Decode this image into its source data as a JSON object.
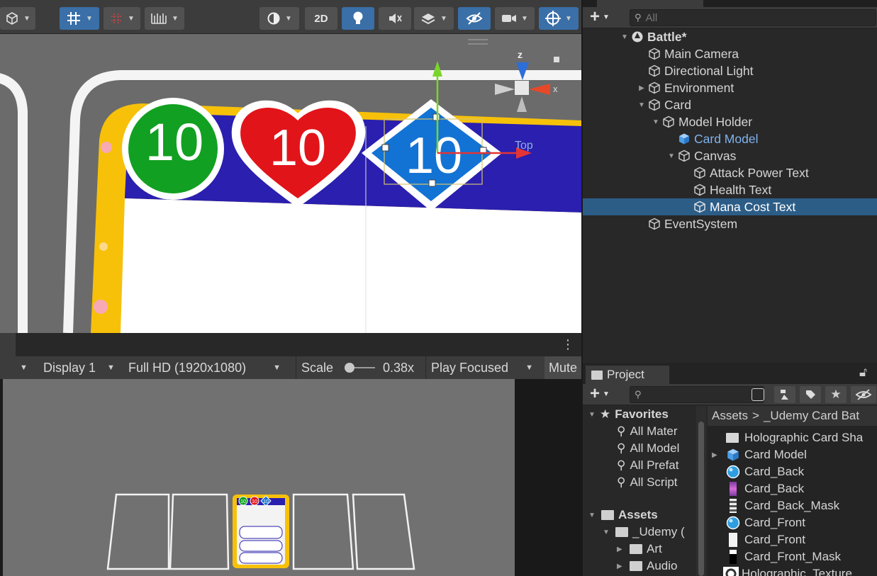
{
  "scene": {
    "toolbar": {
      "btn_2d_label": "2D"
    },
    "gizmo_axis_z": "z",
    "gizmo_axis_x": "x",
    "gizmo_view_label": "Top",
    "card": {
      "attack_value": "10",
      "health_value": "10",
      "mana_value": "10"
    },
    "colors": {
      "attack": "#12a022",
      "health": "#e1141a",
      "mana": "#1273d4",
      "card_border": "#f7c10a",
      "card_band": "#2a1fae"
    }
  },
  "game": {
    "display": "Display 1",
    "resolution": "Full HD (1920x1080)",
    "scale_label": "Scale",
    "scale_value": "0.38x",
    "play_mode": "Play Focused",
    "mute_label": "Mute",
    "mini_card_values": [
      "10",
      "10",
      "10"
    ]
  },
  "hierarchy": {
    "search_placeholder": "All",
    "scene_name": "Battle*",
    "items": [
      {
        "label": "Main Camera"
      },
      {
        "label": "Directional Light"
      },
      {
        "label": "Environment"
      },
      {
        "label": "Card"
      },
      {
        "label": "Model Holder"
      },
      {
        "label": "Card Model"
      },
      {
        "label": "Canvas"
      },
      {
        "label": "Attack Power Text"
      },
      {
        "label": "Health Text"
      },
      {
        "label": "Mana Cost Text"
      },
      {
        "label": "EventSystem"
      }
    ]
  },
  "project": {
    "tab_label": "Project",
    "favorites_label": "Favorites",
    "favorites": [
      "All Mater",
      "All Model",
      "All Prefat",
      "All Script"
    ],
    "assets_label": "Assets",
    "asset_folders": [
      "_Udemy (",
      "Art",
      "Audio"
    ],
    "breadcrumb_root": "Assets",
    "breadcrumb_sep": ">",
    "breadcrumb_current": "_Udemy Card Bat",
    "files": [
      {
        "label": "Holographic Card Sha",
        "icon": "folder-icon"
      },
      {
        "label": "Card Model",
        "icon": "prefab-icon"
      },
      {
        "label": "Card_Back",
        "icon": "material-icon"
      },
      {
        "label": "Card_Back",
        "icon": "texture-icon"
      },
      {
        "label": "Card_Back_Mask",
        "icon": "texture-icon"
      },
      {
        "label": "Card_Front",
        "icon": "material-icon"
      },
      {
        "label": "Card_Front",
        "icon": "texture-icon"
      },
      {
        "label": "Card_Front_Mask",
        "icon": "texture-icon"
      },
      {
        "label": "Holographic_Texture",
        "icon": "texture-icon"
      }
    ]
  }
}
